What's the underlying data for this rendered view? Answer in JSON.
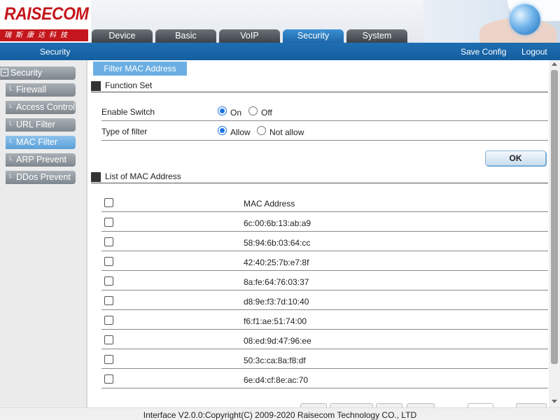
{
  "brand": {
    "logo": "RAISECOM",
    "logo_sub": "瑞斯康达科技"
  },
  "nav": {
    "tabs": [
      {
        "label": "Device"
      },
      {
        "label": "Basic"
      },
      {
        "label": "VoIP"
      },
      {
        "label": "Security",
        "active": true
      },
      {
        "label": "System"
      }
    ]
  },
  "bar": {
    "title": "Security",
    "save_config": "Save Config",
    "logout": "Logout"
  },
  "sidebar": {
    "header": "Security",
    "items": [
      {
        "label": "Firewall"
      },
      {
        "label": "Access Control"
      },
      {
        "label": "URL Filter"
      },
      {
        "label": "MAC Filter",
        "active": true
      },
      {
        "label": "ARP Prevent"
      },
      {
        "label": "DDos Prevent"
      }
    ]
  },
  "page": {
    "tab_title": "Filter MAC Address",
    "function_set": {
      "title": "Function Set",
      "enable_switch": {
        "label": "Enable Switch",
        "on_label": "On",
        "off_label": "Off",
        "selected": "On"
      },
      "filter_type": {
        "label": "Type of filter",
        "allow_label": "Allow",
        "not_allow_label": "Not allow",
        "selected": "Allow"
      },
      "ok_label": "OK"
    },
    "mac_list": {
      "title": "List of MAC Address",
      "column_header": "MAC Address",
      "rows": [
        "6c:00:6b:13:ab:a9",
        "58:94:6b:03:64:cc",
        "42:40:25:7b:e7:8f",
        "8a:fe:64:76:03:37",
        "d8:9e:f3:7d:10:40",
        "f6:f1:ae:51:74:00",
        "08:ed:9d:47:96:ee",
        "50:3c:ca:8a:f8:df",
        "6e:d4:cf:8e:ac:70"
      ]
    }
  },
  "footer": {
    "text": "Interface V2.0.0:Copyright(C) 2009-2020 Raisecom Technology CO., LTD"
  },
  "colors": {
    "brand_red": "#c4161c",
    "bar_blue": "#1a66aa",
    "tab_active": "#2a7cc4",
    "radio_blue": "#1a73e8"
  }
}
